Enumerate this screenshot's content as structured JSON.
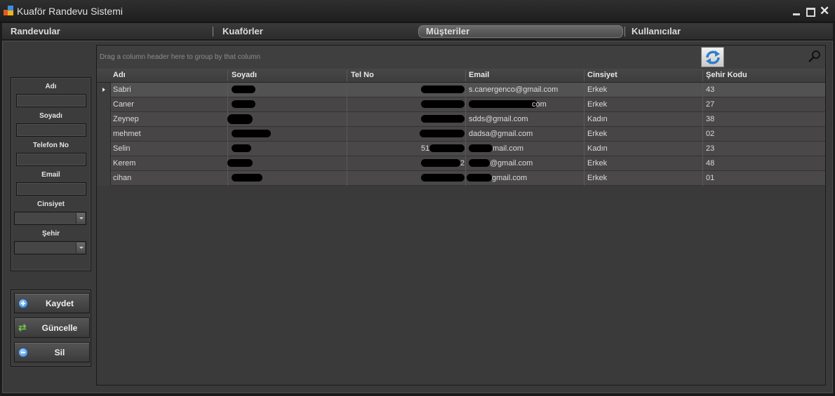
{
  "window": {
    "title": "Kuaför Randevu Sistemi",
    "controls": [
      "minimize",
      "maximize",
      "close"
    ],
    "close_glyph": "✕"
  },
  "menu": {
    "items": [
      {
        "label": "Randevular"
      },
      {
        "label": "Kuaförler"
      },
      {
        "label": "Müşteriler",
        "active": true
      },
      {
        "label": "Kullanıcılar"
      }
    ]
  },
  "form": {
    "fields": [
      {
        "label": "Adı",
        "value": ""
      },
      {
        "label": "Soyadı",
        "value": ""
      },
      {
        "label": "Telefon No",
        "value": ""
      },
      {
        "label": "Email",
        "value": ""
      }
    ],
    "gender": {
      "label": "Cinsiyet",
      "value": ""
    },
    "city": {
      "label": "Şehir",
      "value": ""
    }
  },
  "buttons": {
    "save": {
      "label": "Kaydet",
      "icon": "add-icon"
    },
    "update": {
      "label": "Güncelle",
      "icon": "refresh-icon"
    },
    "delete": {
      "label": "Sil",
      "icon": "remove-icon"
    }
  },
  "grid": {
    "group_hint": "Drag a column header here to group by that column",
    "refresh_icon": "refresh-icon",
    "search_icon": "search-icon",
    "columns": [
      "Adı",
      "Soyadı",
      "Tel No",
      "Email",
      "Cinsiyet",
      "Şehir Kodu"
    ],
    "rows": [
      {
        "name": "Sabri",
        "surname": "",
        "phone": "",
        "email": "s.canergenco@gmail.com",
        "gender": "Erkek",
        "city_code": "43",
        "selected": true
      },
      {
        "name": "Caner",
        "surname": "",
        "phone": "",
        "email": "com",
        "gender": "Erkek",
        "city_code": "27"
      },
      {
        "name": "Zeynep",
        "surname": "",
        "phone": "",
        "email": "sdds@gmail.com",
        "gender": "Kadın",
        "city_code": "38"
      },
      {
        "name": "mehmet",
        "surname": "",
        "phone": "",
        "email": "dadsa@gmail.com",
        "gender": "Erkek",
        "city_code": "02"
      },
      {
        "name": "Selin",
        "surname": "",
        "phone": "51",
        "email": "mail.com",
        "gender": "Kadın",
        "city_code": "23"
      },
      {
        "name": "Kerem",
        "surname": "",
        "phone": "2",
        "email": "@gmail.com",
        "gender": "Erkek",
        "city_code": "48"
      },
      {
        "name": "cihan",
        "surname": "",
        "phone": "",
        "email": "gmail.com",
        "gender": "Erkek",
        "city_code": "01"
      }
    ]
  }
}
